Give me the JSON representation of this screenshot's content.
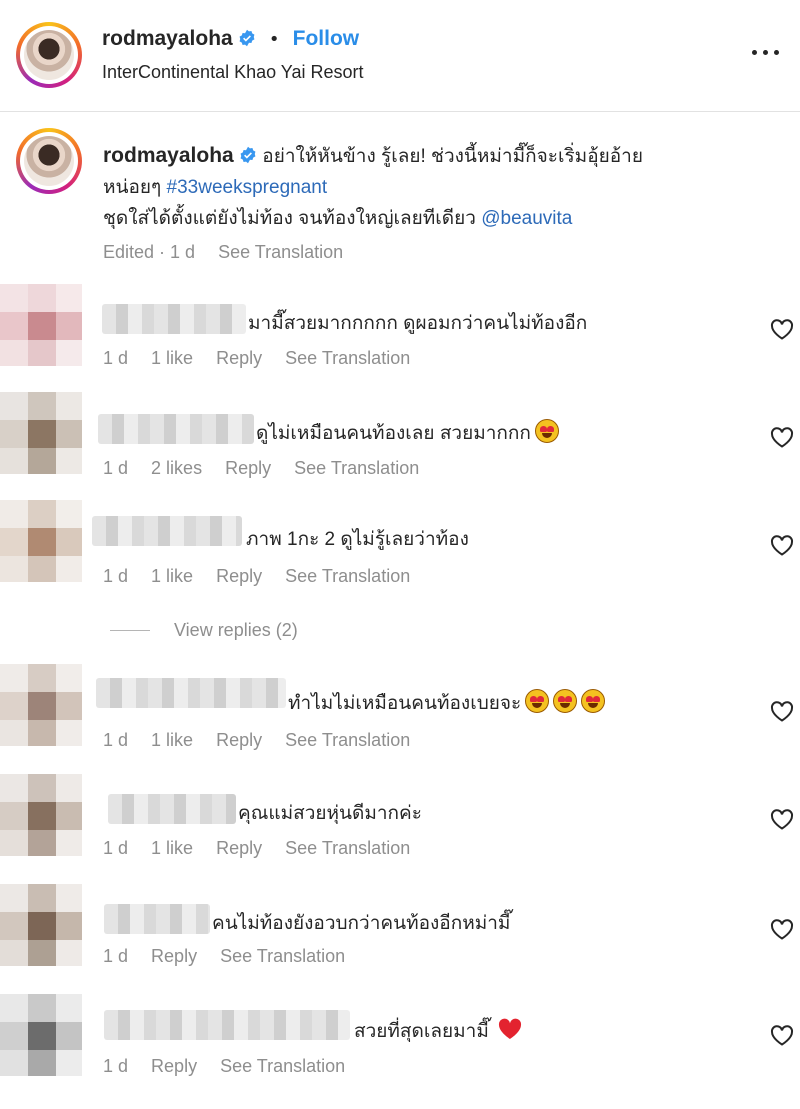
{
  "post": {
    "username": "rodmayaloha",
    "follow_label": "Follow",
    "separator": "•",
    "location": "InterContinental Khao Yai Resort",
    "more_label": "More options"
  },
  "caption": {
    "username": "rodmayaloha",
    "text_line1": "อย่าให้หันข้าง รู้เลย! ช่วงนี้หม่ามี๊ก็จะเริ่มอุ้ยอ้าย",
    "text_line2_pre": "หน่อยๆ ",
    "hashtag": "#33weekspregnant",
    "text_line3": "ชุดใส่ได้ตั้งแต่ยังไม่ท้อง จนท้องใหญ่เลยทีเดียว ",
    "mention": "@beauvita",
    "edited": "Edited · 1 d",
    "see_translation": "See Translation"
  },
  "comments": [
    {
      "text": "มามี๊สวยมากกกกก ดูผอมกว่าคนไม่ท้องอีก",
      "time": "1 d",
      "likes": "1 like",
      "reply": "Reply",
      "translation": "See Translation"
    },
    {
      "text": "ดูไม่เหมือนคนท้องเลย สวยมากกก",
      "emoji": "heart-eyes",
      "time": "1 d",
      "likes": "2 likes",
      "reply": "Reply",
      "translation": "See Translation"
    },
    {
      "text": "ภาพ 1กะ 2 ดูไม่รู้เลยว่าท้อง",
      "time": "1 d",
      "likes": "1 like",
      "reply": "Reply",
      "translation": "See Translation"
    },
    {
      "text": "ทำไมไม่เหมือนคนท้องเบยจะ",
      "emoji": "heart-eyes x3",
      "time": "1 d",
      "likes": "1 like",
      "reply": "Reply",
      "translation": "See Translation"
    },
    {
      "text": "คุณแม่สวยหุ่นดีมากค่ะ",
      "time": "1 d",
      "likes": "1 like",
      "reply": "Reply",
      "translation": "See Translation"
    },
    {
      "text": "คนไม่ท้องยังอวบกว่าคนท้องอีกหม่ามี๊",
      "time": "1 d",
      "reply": "Reply",
      "translation": "See Translation"
    },
    {
      "text": "สวยที่สุดเลยมามี๊",
      "emoji": "red-heart",
      "time": "1 d",
      "reply": "Reply",
      "translation": "See Translation"
    }
  ],
  "view_replies": "View replies (2)",
  "colors": {
    "link": "#2a8de8",
    "hashtag": "#2d6ab8",
    "muted": "#8e8e8e",
    "text": "#262626"
  },
  "icons": [
    "verified-badge-icon",
    "more-options-icon",
    "heart-outline-icon",
    "heart-eyes-emoji",
    "red-heart-emoji"
  ]
}
